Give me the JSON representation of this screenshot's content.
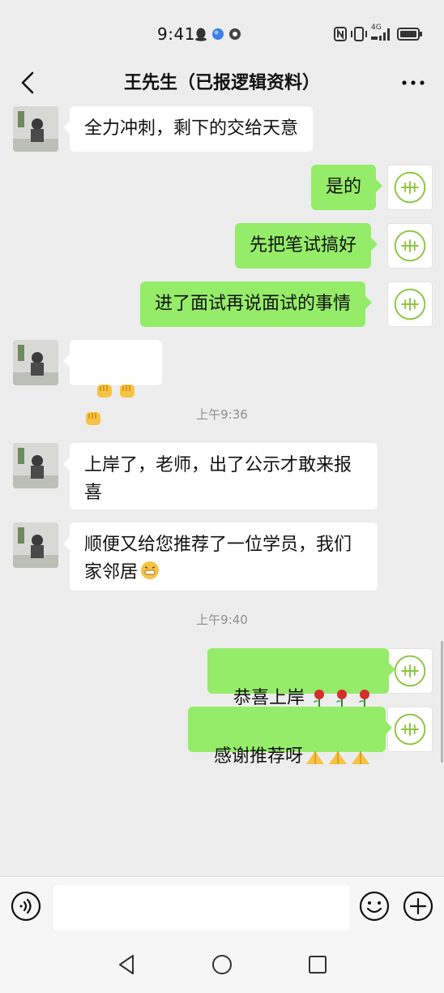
{
  "status_bar": {
    "time": "9:41",
    "icons": [
      "qq-icon",
      "browser-icon",
      "zhihu-icon",
      "nfc-icon",
      "vibrate-icon",
      "signal-icon",
      "battery-icon"
    ],
    "network_label": "4G"
  },
  "header": {
    "title": "王先生（已报逻辑资料）",
    "back_icon": "chevron-left-icon",
    "more_icon": "more-dots-icon"
  },
  "messages": [
    {
      "side": "left",
      "text": "全力冲刺，剩下的交给天意"
    },
    {
      "side": "right",
      "text": "是的"
    },
    {
      "side": "right",
      "text": "先把笔试搞好"
    },
    {
      "side": "right",
      "text": "进了面试再说面试的事情"
    },
    {
      "side": "left",
      "text": "",
      "emojis": [
        "fist-emoji",
        "fist-emoji",
        "fist-emoji"
      ]
    },
    {
      "timestamp": "上午9:36"
    },
    {
      "side": "left",
      "text": "上岸了，老师，出了公示才敢来报\n喜"
    },
    {
      "side": "left",
      "text": "顺便又给您推荐了一位学员，我们\n家邻居",
      "emojis": [
        "grin-emoji"
      ]
    },
    {
      "timestamp": "上午9:40"
    },
    {
      "side": "right",
      "text": "恭喜上岸",
      "emojis": [
        "rose-emoji",
        "rose-emoji",
        "rose-emoji"
      ]
    },
    {
      "side": "right",
      "text": "感谢推荐呀",
      "emojis": [
        "pray-emoji",
        "pray-emoji",
        "pray-emoji"
      ]
    }
  ],
  "input_bar": {
    "voice_icon": "voice-icon",
    "placeholder": "",
    "emoji_icon": "emoji-icon",
    "plus_icon": "plus-icon"
  },
  "navigation": [
    "back-triangle-icon",
    "home-circle-icon",
    "recents-square-icon"
  ],
  "colors": {
    "background": "#ededed",
    "my_bubble": "#95ec69",
    "their_bubble": "#ffffff",
    "timestamp": "#8e8e8e"
  }
}
